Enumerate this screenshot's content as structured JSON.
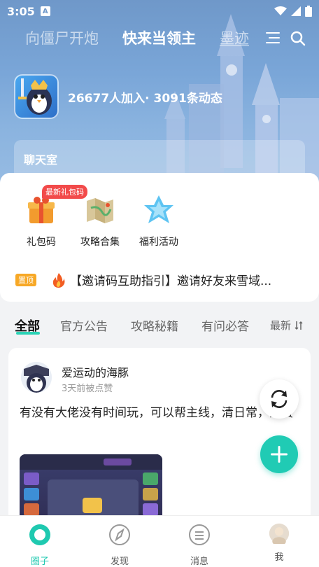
{
  "status_bar": {
    "time": "3:05",
    "app_icon": "A"
  },
  "top_tabs": [
    "向僵尸开炮",
    "快来当领主",
    "墨迹"
  ],
  "circle": {
    "stats": "26677人加入· 3091条动态"
  },
  "chat_room": {
    "title": "聊天室"
  },
  "features": [
    {
      "label": "礼包码",
      "icon": "gift-box-icon"
    },
    {
      "label": "攻略合集",
      "icon": "treasure-map-icon"
    },
    {
      "label": "福利活动",
      "icon": "ice-crystal-icon"
    }
  ],
  "feature_badge": "最新礼包码",
  "pinned": {
    "tag": "置顶",
    "text": "【邀请码互助指引】邀请好友来雪域..."
  },
  "categories": [
    "全部",
    "官方公告",
    "攻略秘籍",
    "有问必答",
    "最新"
  ],
  "post": {
    "author": "爱运动的海豚",
    "meta": "3天前被点赞",
    "text": "有没有大佬没有时间玩，可以帮主线，清日常，免费"
  },
  "bottom_nav": [
    {
      "label": "圈子",
      "icon": "circle-icon"
    },
    {
      "label": "发现",
      "icon": "compass-icon"
    },
    {
      "label": "消息",
      "icon": "message-icon"
    },
    {
      "label": "我",
      "icon": "avatar-icon"
    }
  ],
  "colors": {
    "accent": "#20cbb4",
    "badge": "#f24a4a",
    "pin": "#f7a826"
  }
}
